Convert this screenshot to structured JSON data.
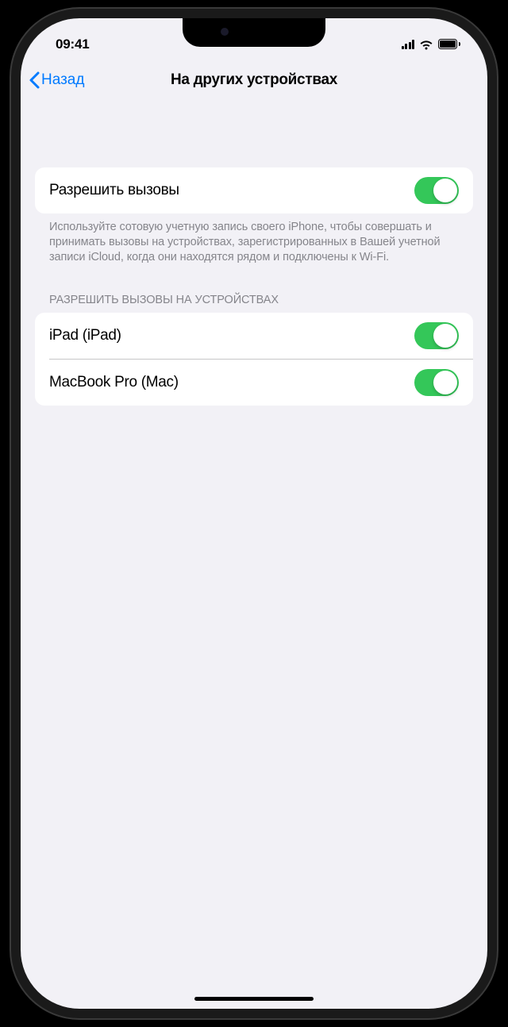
{
  "status": {
    "time": "09:41"
  },
  "nav": {
    "back_label": "Назад",
    "title": "На других устройствах"
  },
  "allow_calls": {
    "label": "Разрешить вызовы",
    "on": true,
    "footer": "Используйте сотовую учетную запись своего iPhone, чтобы совершать и принимать вызовы на устройствах, зарегистрированных в Вашей учетной записи iCloud, когда они находятся рядом и подключены к Wi-Fi."
  },
  "devices_section": {
    "header": "РАЗРЕШИТЬ ВЫЗОВЫ НА УСТРОЙСТВАХ",
    "items": [
      {
        "label": "iPad (iPad)",
        "on": true
      },
      {
        "label": "MacBook Pro (Mac)",
        "on": true
      }
    ]
  },
  "colors": {
    "accent": "#007aff",
    "toggle_on": "#34c759",
    "background": "#f2f1f6"
  }
}
